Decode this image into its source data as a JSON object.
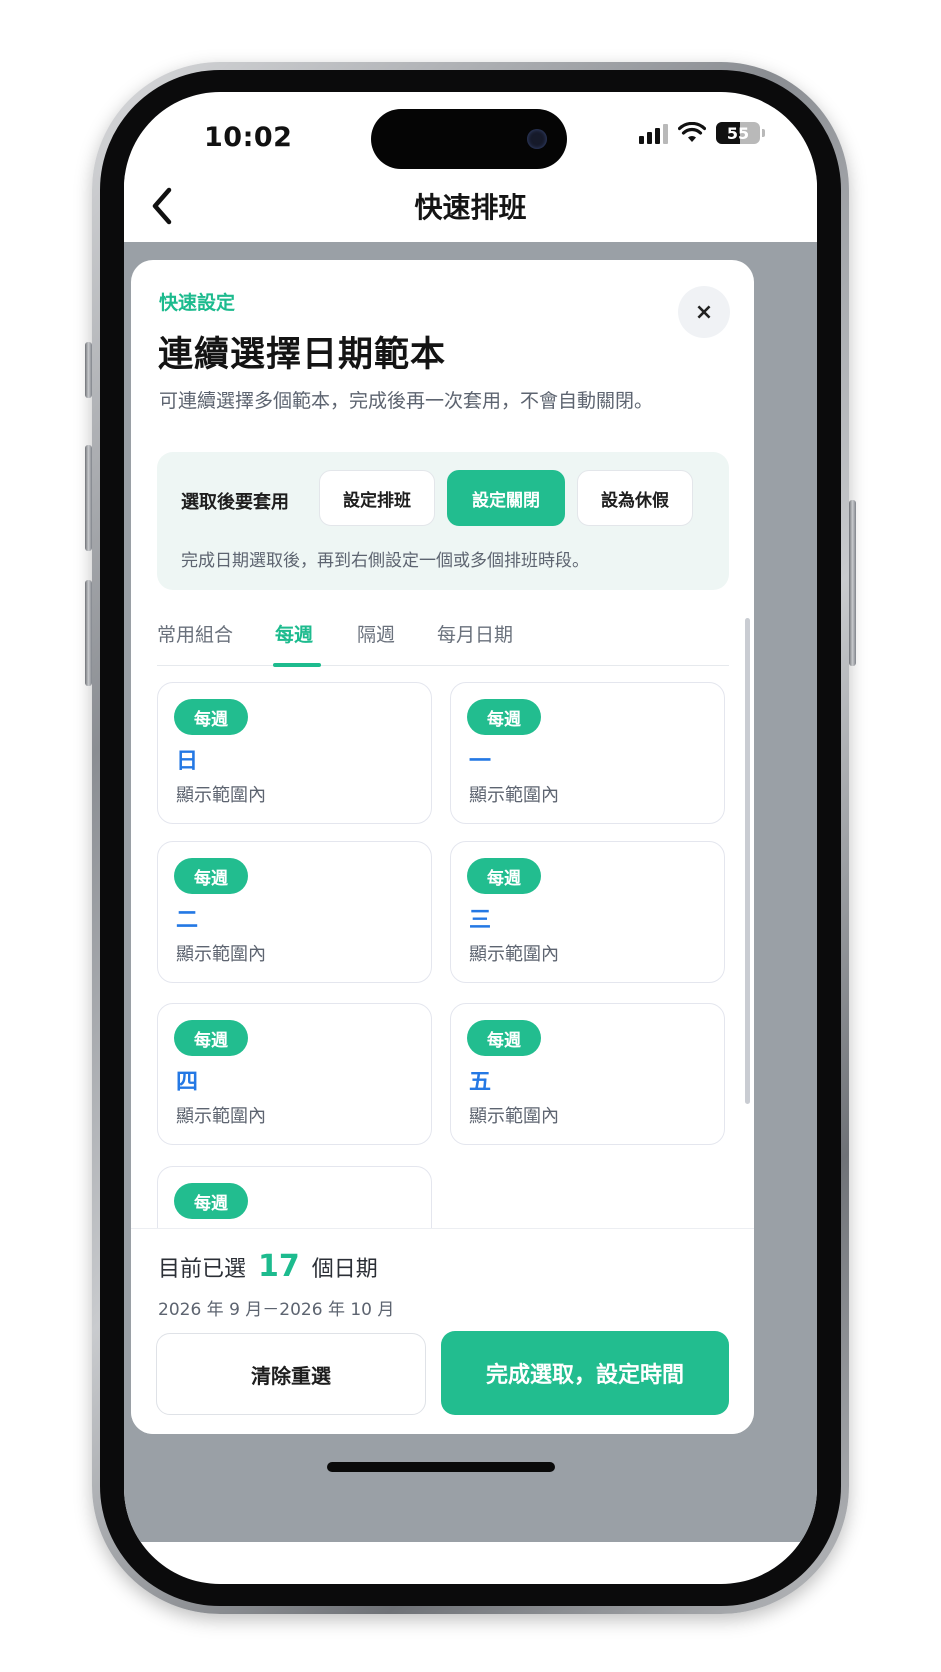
{
  "status_bar": {
    "time": "10:02",
    "battery_level": "55"
  },
  "nav": {
    "title": "快速排班",
    "back_icon": "chevron-left-icon"
  },
  "sheet": {
    "eyebrow": "快速設定",
    "title": "連續選擇日期範本",
    "description": "可連續選擇多個範本，完成後再一次套用，不會自動關閉。",
    "close_label": "×",
    "apply": {
      "label": "選取後要套用",
      "options": [
        {
          "label": "設定排班",
          "active": false
        },
        {
          "label": "設定關閉",
          "active": true
        },
        {
          "label": "設為休假",
          "active": false
        }
      ],
      "hint": "完成日期選取後，再到右側設定一個或多個排班時段。"
    },
    "tabs": [
      {
        "label": "常用組合",
        "active": false
      },
      {
        "label": "每週",
        "active": true
      },
      {
        "label": "隔週",
        "active": false
      },
      {
        "label": "每月日期",
        "active": false
      }
    ],
    "cards": [
      {
        "badge": "每週",
        "day": "日",
        "sub": "顯示範圍內"
      },
      {
        "badge": "每週",
        "day": "一",
        "sub": "顯示範圍內"
      },
      {
        "badge": "每週",
        "day": "二",
        "sub": "顯示範圍內"
      },
      {
        "badge": "每週",
        "day": "三",
        "sub": "顯示範圍內"
      },
      {
        "badge": "每週",
        "day": "四",
        "sub": "顯示範圍內"
      },
      {
        "badge": "每週",
        "day": "五",
        "sub": "顯示範圍內"
      },
      {
        "badge": "每週",
        "day": "",
        "sub": ""
      }
    ],
    "footer": {
      "selected_prefix": "目前已選",
      "selected_count": "17",
      "selected_suffix": "個日期",
      "range": "2026 年 9 月－2026 年 10 月",
      "clear_label": "清除重選",
      "done_label": "完成選取，設定時間"
    }
  },
  "colors": {
    "accent": "#22bd8f",
    "day_blue": "#2478e4"
  }
}
